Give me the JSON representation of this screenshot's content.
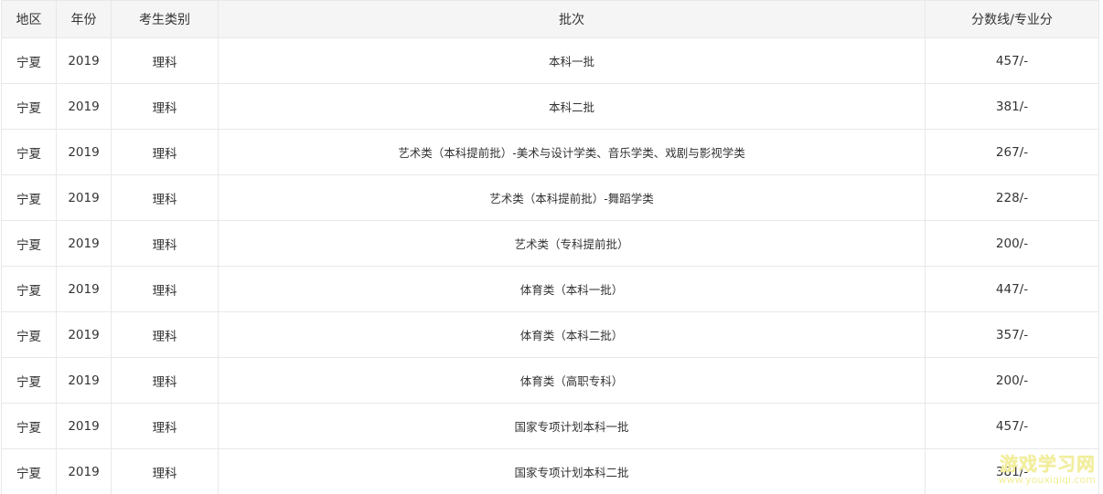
{
  "table": {
    "headers": [
      "地区",
      "年份",
      "考生类别",
      "批次",
      "分数线/专业分"
    ],
    "rows": [
      [
        "宁夏",
        "2019",
        "理科",
        "本科一批",
        "457/-"
      ],
      [
        "宁夏",
        "2019",
        "理科",
        "本科二批",
        "381/-"
      ],
      [
        "宁夏",
        "2019",
        "理科",
        "艺术类（本科提前批）-美术与设计学类、音乐学类、戏剧与影视学类",
        "267/-"
      ],
      [
        "宁夏",
        "2019",
        "理科",
        "艺术类（本科提前批）-舞蹈学类",
        "228/-"
      ],
      [
        "宁夏",
        "2019",
        "理科",
        "艺术类（专科提前批）",
        "200/-"
      ],
      [
        "宁夏",
        "2019",
        "理科",
        "体育类（本科一批）",
        "447/-"
      ],
      [
        "宁夏",
        "2019",
        "理科",
        "体育类（本科二批）",
        "357/-"
      ],
      [
        "宁夏",
        "2019",
        "理科",
        "体育类（高职专科）",
        "200/-"
      ],
      [
        "宁夏",
        "2019",
        "理科",
        "国家专项计划本科一批",
        "457/-"
      ],
      [
        "宁夏",
        "2019",
        "理科",
        "国家专项计划本科二批",
        "381/-"
      ]
    ]
  },
  "watermark": {
    "title": "游戏学习网",
    "url": "www.youxiqiqi.com"
  },
  "colors": {
    "header_bg": "#f5f5f5",
    "border": "#e8e8e8",
    "text": "#333333",
    "watermark": "#f2ee9a"
  }
}
